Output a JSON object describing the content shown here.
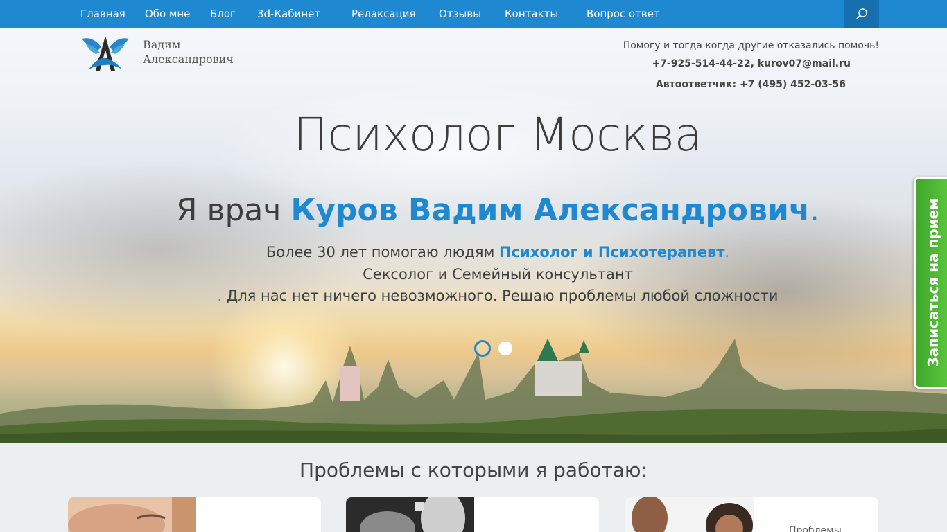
{
  "nav": {
    "items": [
      "Главная",
      "Обо мне",
      "Блог",
      "3d-Кабинет",
      "Релаксация",
      "Отзывы",
      "Контакты",
      "Вопрос ответ"
    ],
    "search_icon": "search-icon"
  },
  "brand": {
    "first": "Вадим",
    "last": "Александрович"
  },
  "contact": {
    "tagline": "Помогу и тогда когда другие отказались помочь!",
    "phone_email": "+7-925-514-44-22, kurov07@mail.ru",
    "answering": "Автоответчик: +7 (495) 452-03-56"
  },
  "hero": {
    "title": "Психолог Москва",
    "sub_prefix": "Я врач ",
    "sub_name": "Куров Вадим Александрович",
    "sub_suffix": ".",
    "desc1_prefix": "Более 30 лет помогаю людям ",
    "desc1_strong": "Психолог и Психотерапевт",
    "desc1_suffix": ".",
    "desc2": "Сексолог и Семейный консультант",
    "desc3_dot": ".",
    "desc3": " Для нас нет ничего невозможного. Решаю проблемы любой сложности"
  },
  "appointment": "Записаться на прием",
  "problems": {
    "title": "Проблемы с которыми я работаю:",
    "card3_text": "Проблемы"
  },
  "colors": {
    "accent": "#1e88d0",
    "button_green": "#4bb534"
  }
}
